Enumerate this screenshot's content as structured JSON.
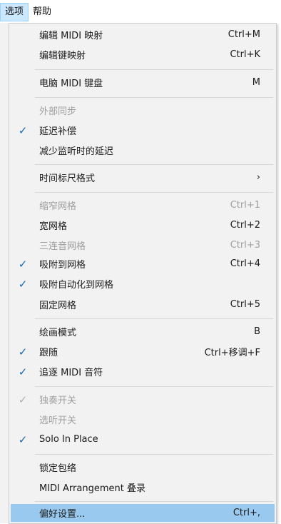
{
  "menubar": {
    "options": "选项",
    "help": "帮助"
  },
  "menu": [
    {
      "label": "编辑 MIDI 映射",
      "shortcut": "Ctrl+M",
      "checked": false,
      "disabled": false
    },
    {
      "label": "编辑键映射",
      "shortcut": "Ctrl+K",
      "checked": false,
      "disabled": false
    },
    {
      "label": "电脑 MIDI 键盘",
      "shortcut": "M",
      "checked": false,
      "disabled": false
    },
    {
      "label": "外部同步",
      "shortcut": "",
      "checked": false,
      "disabled": true
    },
    {
      "label": "延迟补偿",
      "shortcut": "",
      "checked": true,
      "disabled": false
    },
    {
      "label": "减少监听时的延迟",
      "shortcut": "",
      "checked": false,
      "disabled": false
    },
    {
      "label": "时间标尺格式",
      "shortcut": "›",
      "checked": false,
      "disabled": false
    },
    {
      "label": "缩窄网格",
      "shortcut": "Ctrl+1",
      "checked": false,
      "disabled": true
    },
    {
      "label": "宽网格",
      "shortcut": "Ctrl+2",
      "checked": false,
      "disabled": false
    },
    {
      "label": "三连音网格",
      "shortcut": "Ctrl+3",
      "checked": false,
      "disabled": true
    },
    {
      "label": "吸附到网格",
      "shortcut": "Ctrl+4",
      "checked": true,
      "disabled": false
    },
    {
      "label": "吸附自动化到网格",
      "shortcut": "",
      "checked": true,
      "disabled": false
    },
    {
      "label": "固定网格",
      "shortcut": "Ctrl+5",
      "checked": false,
      "disabled": false
    },
    {
      "label": "绘画模式",
      "shortcut": "B",
      "checked": false,
      "disabled": false
    },
    {
      "label": "跟随",
      "shortcut": "Ctrl+移调+F",
      "checked": true,
      "disabled": false
    },
    {
      "label": "追逐 MIDI 音符",
      "shortcut": "",
      "checked": true,
      "disabled": false
    },
    {
      "label": "独奏开关",
      "shortcut": "",
      "checked": true,
      "disabled": true
    },
    {
      "label": "选听开关",
      "shortcut": "",
      "checked": false,
      "disabled": true
    },
    {
      "label": "Solo In Place",
      "shortcut": "",
      "checked": true,
      "disabled": false
    },
    {
      "label": "锁定包络",
      "shortcut": "",
      "checked": false,
      "disabled": false
    },
    {
      "label": "MIDI Arrangement 叠录",
      "shortcut": "",
      "checked": false,
      "disabled": false
    },
    {
      "label": "偏好设置...",
      "shortcut": "Ctrl+,",
      "checked": false,
      "disabled": false,
      "highlighted": true
    }
  ],
  "icons": {
    "check": "checkmark-icon",
    "submenu": "chevron-right-icon"
  },
  "colors": {
    "highlight": "#99c9ef",
    "check": "#1a66b3",
    "disabled": "#a0a0a0"
  }
}
